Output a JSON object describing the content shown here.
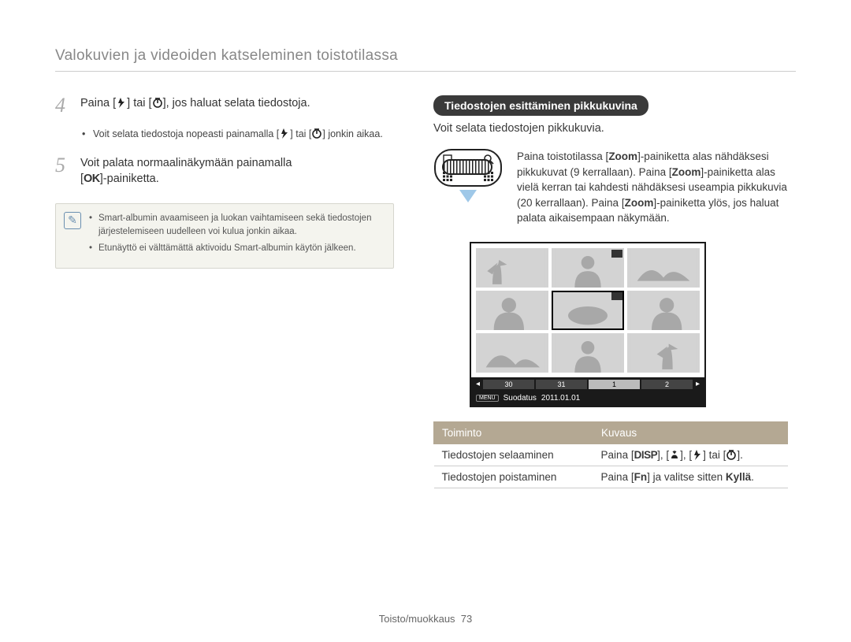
{
  "header": "Valokuvien ja videoiden katseleminen toistotilassa",
  "steps": {
    "s4": {
      "num": "4",
      "pre": "Paina [",
      "mid": "] tai [",
      "post": "], jos haluat selata tiedostoja.",
      "bullet_pre": "Voit selata tiedostoja nopeasti painamalla [",
      "bullet_mid": "] tai [",
      "bullet_post": "] jonkin aikaa."
    },
    "s5": {
      "num": "5",
      "line1": "Voit palata normaalinäkymään painamalla",
      "line2_pre": "[",
      "ok": "OK",
      "line2_post": "]-painiketta."
    }
  },
  "note": {
    "b1": "Smart-albumin avaamiseen ja luokan vaihtamiseen sekä tiedostojen järjestelemiseen uudelleen voi kulua jonkin aikaa.",
    "b2": "Etunäyttö ei välttämättä aktivoidu Smart-albumin käytön jälkeen."
  },
  "right": {
    "badge": "Tiedostojen esittäminen pikkukuvina",
    "intro": "Voit selata tiedostojen pikkukuvia.",
    "zoom_text_1": "Paina toistotilassa [",
    "zoom1": "Zoom",
    "zoom_text_2": "]-painiketta alas nähdäksesi pikkukuvat (9 kerrallaan). Paina [",
    "zoom2": "Zoom",
    "zoom_text_3": "]-painiketta alas vielä kerran tai kahdesti nähdäksesi useampia pikkukuvia (20 kerrallaan). Paina [",
    "zoom3": "Zoom",
    "zoom_text_4": "]-painiketta ylös, jos haluat palata aikaisempaan näkymään."
  },
  "screen": {
    "tl": [
      "30",
      "31",
      "1",
      "2"
    ],
    "menu": "MENU",
    "filter_label": "Suodatus",
    "date": "2011.01.01"
  },
  "table": {
    "h1": "Toiminto",
    "h2": "Kuvaus",
    "r1c1": "Tiedostojen selaaminen",
    "r1c2_pre": "Paina [",
    "disp": "DISP",
    "r1c2_mid1": "], [",
    "r1c2_mid2": "], [",
    "r1c2_mid3": "] tai [",
    "r1c2_post": "].",
    "r2c1": "Tiedostojen poistaminen",
    "r2c2_pre": "Paina [",
    "fn": "Fn",
    "r2c2_mid": "] ja valitse sitten ",
    "kylla": "Kyllä",
    "r2c2_post": "."
  },
  "footer": {
    "section": "Toisto/muokkaus",
    "page": "73"
  }
}
